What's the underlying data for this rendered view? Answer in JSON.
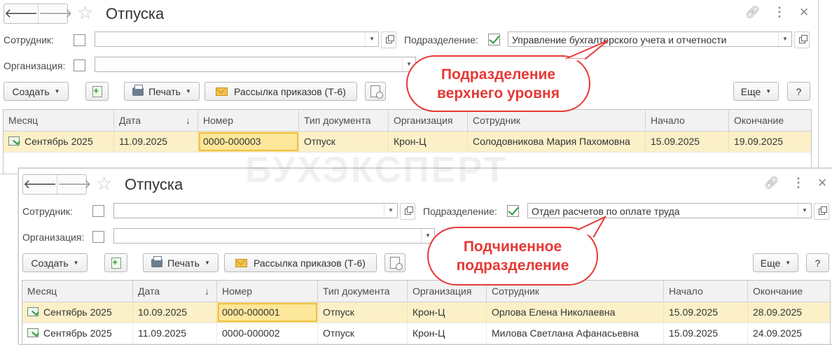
{
  "windows": [
    {
      "title": "Отпуска",
      "employee_label": "Сотрудник:",
      "employee_value": "",
      "department_label": "Подразделение:",
      "department_checked": true,
      "department_value": "Управление бухгалтерского учета и отчетности",
      "organization_label": "Организация:",
      "organization_value": "",
      "toolbar": {
        "create": "Создать",
        "print": "Печать",
        "mailing": "Рассылка приказов (Т-6)",
        "more": "Еще",
        "help": "?"
      },
      "columns": [
        "Месяц",
        "Дата",
        "Номер",
        "Тип документа",
        "Организация",
        "Сотрудник",
        "Начало",
        "Окончание"
      ],
      "rows": [
        {
          "month": "Сентябрь 2025",
          "date": "11.09.2025",
          "number": "0000-000003",
          "type": "Отпуск",
          "org": "Крон-Ц",
          "employee": "Солодовникова Мария Пахомовна",
          "start": "15.09.2025",
          "end": "19.09.2025",
          "selected": true
        }
      ]
    },
    {
      "title": "Отпуска",
      "employee_label": "Сотрудник:",
      "employee_value": "",
      "department_label": "Подразделение:",
      "department_checked": true,
      "department_value": "Отдел расчетов по оплате труда",
      "organization_label": "Организация:",
      "organization_value": "",
      "toolbar": {
        "create": "Создать",
        "print": "Печать",
        "mailing": "Рассылка приказов (Т-6)",
        "more": "Еще",
        "help": "?"
      },
      "columns": [
        "Месяц",
        "Дата",
        "Номер",
        "Тип документа",
        "Организация",
        "Сотрудник",
        "Начало",
        "Окончание"
      ],
      "rows": [
        {
          "month": "Сентябрь 2025",
          "date": "10.09.2025",
          "number": "0000-000001",
          "type": "Отпуск",
          "org": "Крон-Ц",
          "employee": "Орлова Елена Николаевна",
          "start": "15.09.2025",
          "end": "28.09.2025",
          "selected": true
        },
        {
          "month": "Сентябрь 2025",
          "date": "11.09.2025",
          "number": "0000-000002",
          "type": "Отпуск",
          "org": "Крон-Ц",
          "employee": "Милова Светлана Афанасьевна",
          "start": "15.09.2025",
          "end": "24.09.2025",
          "selected": false
        }
      ]
    }
  ],
  "callouts": {
    "top": "Подразделение верхнего уровня",
    "bottom": "Подчиненное подразделение"
  },
  "watermark": "БУХЭКСПЕРТ",
  "colors": {
    "callout": "#e53935",
    "selected_row": "#fbf0c8",
    "check": "#2e9a3c"
  }
}
